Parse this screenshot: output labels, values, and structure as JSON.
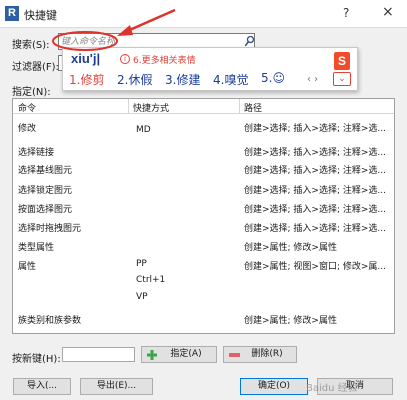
{
  "window": {
    "title": "快捷键",
    "help_label": "?",
    "close_label": "×"
  },
  "search": {
    "label": "搜索(S):",
    "placeholder": "键入命令名称",
    "value": ""
  },
  "filter": {
    "label": "过滤器(F):"
  },
  "assignments_label": "指定(N):",
  "ime": {
    "composition": "xiu'j|",
    "hint_icon": "i",
    "hint": "6.更多相关表情",
    "candidates": [
      "1.修剪",
      "2.休假",
      "3.修建",
      "4.嗅觉",
      "5.☺"
    ],
    "logo": "S",
    "arrows": "‹ ›",
    "down": "⌄"
  },
  "table": {
    "headers": [
      "命令",
      "快捷方式",
      "路径"
    ],
    "rows": [
      {
        "command": "修改",
        "shortcuts": [
          "MD"
        ],
        "path": "创建>选择; 插入>选择; 注释>选..."
      },
      {
        "command": "选择链接",
        "shortcuts": [],
        "path": "创建>选择; 插入>选择; 注释>选..."
      },
      {
        "command": "选择基线图元",
        "shortcuts": [],
        "path": "创建>选择; 插入>选择; 注释>选..."
      },
      {
        "command": "选择锁定图元",
        "shortcuts": [],
        "path": "创建>选择; 插入>选择; 注释>选..."
      },
      {
        "command": "按面选择图元",
        "shortcuts": [],
        "path": "创建>选择; 插入>选择; 注释>选..."
      },
      {
        "command": "选择时拖拽图元",
        "shortcuts": [],
        "path": "创建>选择; 插入>选择; 注释>选..."
      },
      {
        "command": "类型属性",
        "shortcuts": [],
        "path": "创建>属性; 修改>属性"
      },
      {
        "command": "属性",
        "shortcuts": [
          "PP",
          "Ctrl+1",
          "VP"
        ],
        "path": "创建>属性; 视图>窗口; 修改>属..."
      },
      {
        "command": "族类别和族参数",
        "shortcuts": [],
        "path": "创建>属性; 修改>属性"
      }
    ]
  },
  "assign_bar": {
    "label": "按新键(H):",
    "assign_button": "指定(A)",
    "remove_button": "删除(R)"
  },
  "footer": {
    "import_button": "导入(...",
    "export_button": "导出(E)...",
    "ok_button": "确定(O)",
    "cancel_button": "取消"
  },
  "watermark": "Baidu 经验"
}
